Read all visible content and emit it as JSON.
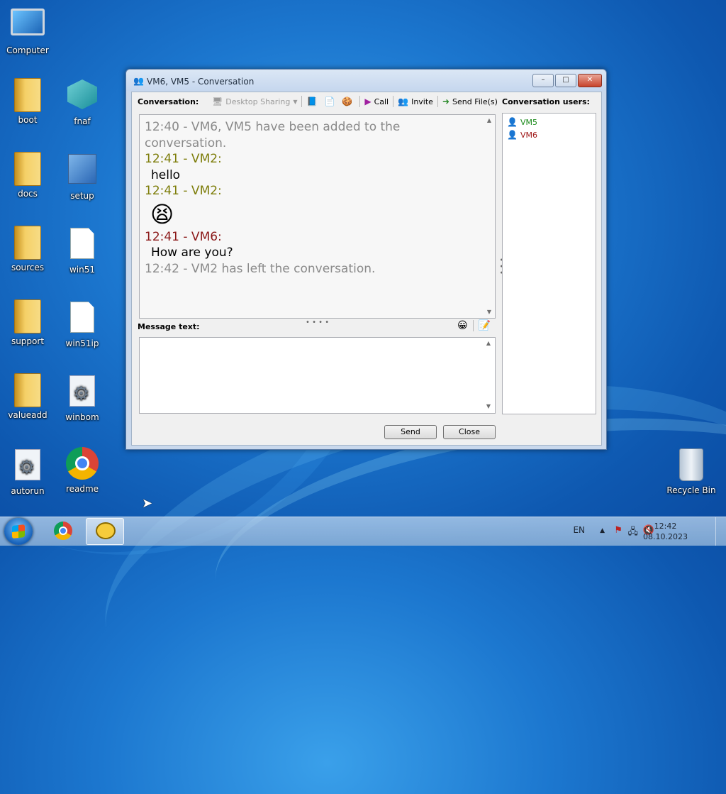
{
  "desktop": {
    "icons": [
      {
        "label": "Computer",
        "icon": "computer-icon"
      },
      {
        "label": "boot",
        "icon": "folder-icon"
      },
      {
        "label": "fnaf",
        "icon": "cube-icon"
      },
      {
        "label": "docs",
        "icon": "folder-icon"
      },
      {
        "label": "setup",
        "icon": "setup-icon"
      },
      {
        "label": "sources",
        "icon": "folder-icon"
      },
      {
        "label": "win51",
        "icon": "file-icon"
      },
      {
        "label": "support",
        "icon": "folder-icon"
      },
      {
        "label": "win51ip",
        "icon": "file-icon"
      },
      {
        "label": "valueadd",
        "icon": "folder-icon"
      },
      {
        "label": "winbom",
        "icon": "settings-file-icon"
      },
      {
        "label": "autorun",
        "icon": "settings-file-icon"
      },
      {
        "label": "readme",
        "icon": "chrome-icon"
      },
      {
        "label": "Recycle Bin",
        "icon": "recycle-bin-icon"
      }
    ]
  },
  "window": {
    "title": "VM6, VM5 - Conversation",
    "minimize": "–",
    "maximize": "□",
    "close": "✕",
    "conversation_label": "Conversation:",
    "toolbar": {
      "desktop_sharing": "Desktop Sharing",
      "call": "Call",
      "invite": "Invite",
      "send_files": "Send File(s)"
    },
    "users_label": "Conversation users:",
    "users": [
      {
        "name": "VM5",
        "color": "#1a8a1a"
      },
      {
        "name": "VM6",
        "color": "#a01818"
      }
    ],
    "messages": {
      "m1": "12:40 - VM6, VM5 have been added to the conversation.",
      "m2_header": "12:41 - VM2:",
      "m2_body": "hello",
      "m3_header": "12:41 - VM2:",
      "m3_emoji": "😫",
      "m4_header": "12:41 - VM6:",
      "m4_body": "How are you?",
      "m5": "12:42 - VM2 has left the conversation."
    },
    "message_text_label": "Message text:",
    "message_value": "",
    "send_label": "Send",
    "close_label": "Close"
  },
  "taskbar": {
    "language": "EN",
    "time": "12:42",
    "date": "08.10.2023"
  }
}
